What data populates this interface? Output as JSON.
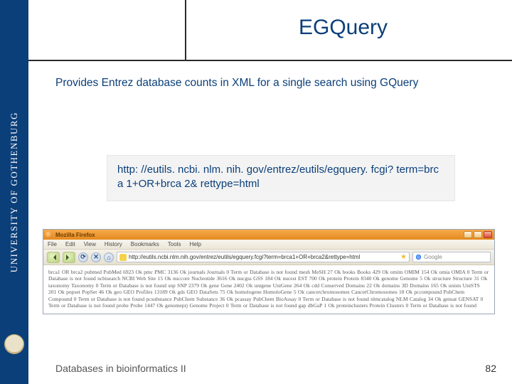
{
  "left_band": {
    "text": "UNIVERSITY OF GOTHENBURG"
  },
  "header": {
    "title": "EGQuery"
  },
  "subtitle": "Provides Entrez database counts in XML for a single search using GQuery",
  "url_box": "http: //eutils. ncbi. nlm. nih. gov/entrez/eutils/egquery. fcgi? term=brca 1+OR+brca 2& rettype=html",
  "browser": {
    "window_title": "Mozilla Firefox",
    "menu": [
      "File",
      "Edit",
      "View",
      "History",
      "Bookmarks",
      "Tools",
      "Help"
    ],
    "address": "http://eutils.ncbi.nlm.nih.gov/entrez/eutils/egquery.fcgi?term=brca1+OR+brca2&rettype=html",
    "search_placeholder": "Google",
    "body": "brca1 OR brca2 pubmed PubMed 6923 Ok pmc PMC 3136 Ok journals Journals 0 Term or Database is not found mesh MeSH 27 Ok books Books 429 Ok omim OMIM 154 Ok omia OMIA 0 Term or Database is not found ncbisearch NCBI Web Site 15 Ok nuccore Nucleotide 3616 Ok nucgss GSS 184 Ok nucest EST 700 Ok protein Protein 8340 Ok genome Genome 5 Ok structure Structure 31 Ok taxonomy Taxonomy 0 Term or Database is not found snp SNP 2379 Ok gene Gene 2402 Ok unigene UniGene 264 Ok cdd Conserved Domains 22 Ok domains 3D Domains 165 Ok unists UniSTS 201 Ok popset PopSet 46 Ok geo GEO Profiles 13189 Ok gds GEO DataSets 75 Ok homologene HomoloGene 5 Ok cancerchromosomes CancerChromosomes 18 Ok pccompound PubChem Compound 0 Term or Database is not found pcsubstance PubChem Substance 36 Ok pcassay PubChem BioAssay 0 Term or Database is not found nlmcatalog NLM Catalog 34 Ok gensat GENSAT 0 Term or Database is not found probe Probe 1447 Ok genomeprj Genome Project 0 Term or Database is not found gap dbGaP 1 Ok proteinclusters Protein Clusters 0 Term or Database is not found"
  },
  "footer": {
    "left": "Databases in bioinformatics II",
    "page": "82"
  }
}
